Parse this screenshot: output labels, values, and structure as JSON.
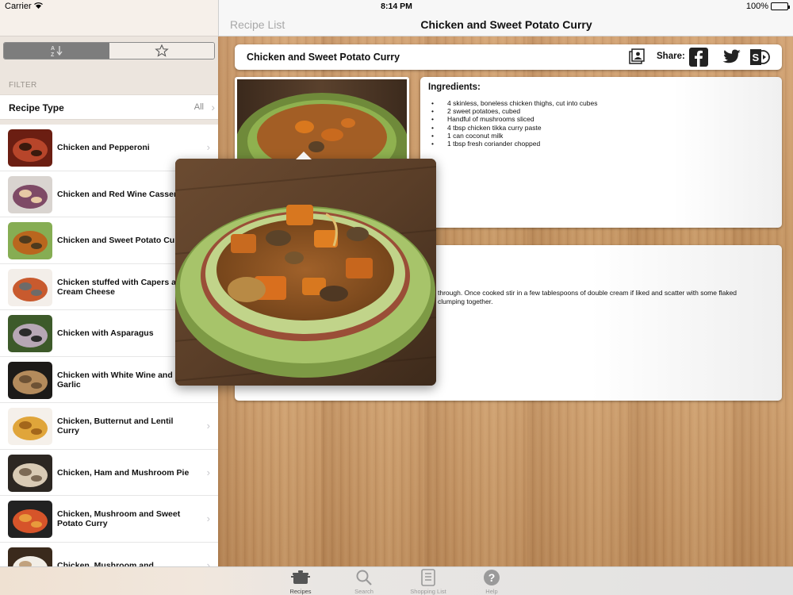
{
  "status_bar": {
    "carrier": "Carrier",
    "time": "8:14 PM",
    "battery": "100%"
  },
  "nav": {
    "back_label": "Recipe List",
    "title": "Chicken and Sweet Potato Curry"
  },
  "filter": {
    "label": "FILTER",
    "recipe_type_label": "Recipe Type",
    "recipe_type_value": "All",
    "sort_label": "A Z"
  },
  "recipes": [
    {
      "name": "Chicken and Pepperoni",
      "colors": [
        "#6b1e12",
        "#b7452a",
        "#3b1a0d"
      ]
    },
    {
      "name": "Chicken and Red Wine Casserole",
      "colors": [
        "#d9d4d0",
        "#7e4a66",
        "#e7c9a5"
      ]
    },
    {
      "name": "Chicken and Sweet Potato Curry",
      "colors": [
        "#86ad53",
        "#b9661e",
        "#4e3a1e"
      ]
    },
    {
      "name": "Chicken stuffed with Capers and Cream Cheese",
      "colors": [
        "#f3eee9",
        "#c85a2e",
        "#6d6b69"
      ]
    },
    {
      "name": "Chicken with Asparagus",
      "colors": [
        "#3d5a2a",
        "#b7a7b5",
        "#2b2b2b"
      ]
    },
    {
      "name": "Chicken with White Wine and Garlic",
      "colors": [
        "#1c1a18",
        "#b48b5c",
        "#6d5235"
      ]
    },
    {
      "name": "Chicken, Butternut and Lentil Curry",
      "colors": [
        "#f5f0ea",
        "#e0a53a",
        "#a3661b"
      ]
    },
    {
      "name": "Chicken, Ham and Mushroom Pie",
      "colors": [
        "#2c2722",
        "#d9cbb5",
        "#7c6a55"
      ]
    },
    {
      "name": "Chicken, Mushroom and Sweet Potato Curry",
      "colors": [
        "#222",
        "#d6542a",
        "#e89a3c"
      ]
    },
    {
      "name": "Chicken, Mushroom and",
      "colors": [
        "#3a2a1c",
        "#f2eee6",
        "#c1a27e"
      ]
    }
  ],
  "recipe": {
    "title": "Chicken and Sweet Potato Curry",
    "share_label": "Share:",
    "ingredients_heading": "Ingredients:",
    "ingredients": [
      "4 skinless, boneless chicken thighs, cut into cubes",
      "2 sweet potatoes, cubed",
      "Handful of mushrooms sliced",
      "4 tbsp chicken tikka curry paste",
      "1 can coconut milk",
      "1 tbsp fresh coriander chopped"
    ],
    "method_line1": "through. Once cooked stir in a few tablespoons of double cream if liked and scatter with some flaked",
    "method_line2": "clumping together."
  },
  "tabs": [
    {
      "label": "Recipes",
      "icon": "pot-icon",
      "active": true
    },
    {
      "label": "Search",
      "icon": "search-icon",
      "active": false
    },
    {
      "label": "Shopping List",
      "icon": "list-icon",
      "active": false
    },
    {
      "label": "Help",
      "icon": "help-icon",
      "active": false
    }
  ]
}
